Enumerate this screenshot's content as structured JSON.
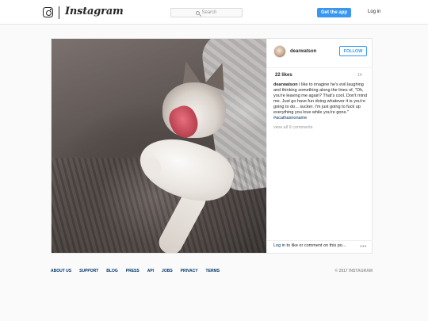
{
  "header": {
    "wordmark": "Instagram",
    "search_placeholder": "Search",
    "get_app_label": "Get the app",
    "login_label": "Log in"
  },
  "post": {
    "username": "dearwatson",
    "follow_label": "FOLLOW",
    "likes": "22 likes",
    "time": "1h",
    "caption_user": "dearwatson",
    "caption_text": " I like to imagine he's evil laughing and thinking something along the lines of, \"Oh, you're leaving me again? That's cool. Don't mind me. Just go have fun doing whatever it is you're going to do... sucker. I'm just going to fuck up everything you love while you're gone.\"",
    "hashtag": "#acathasnoname",
    "view_all": "view all 9 comments",
    "login_link": "Log in",
    "login_rest": " to like or comment on this po...",
    "more_icon": "•••"
  },
  "footer": {
    "links": [
      "ABOUT US",
      "SUPPORT",
      "BLOG",
      "PRESS",
      "API",
      "JOBS",
      "PRIVACY",
      "TERMS"
    ],
    "copyright": "© 2017 INSTAGRAM"
  },
  "colors": {
    "accent": "#3897f0",
    "link": "#003569",
    "muted": "#999999"
  }
}
